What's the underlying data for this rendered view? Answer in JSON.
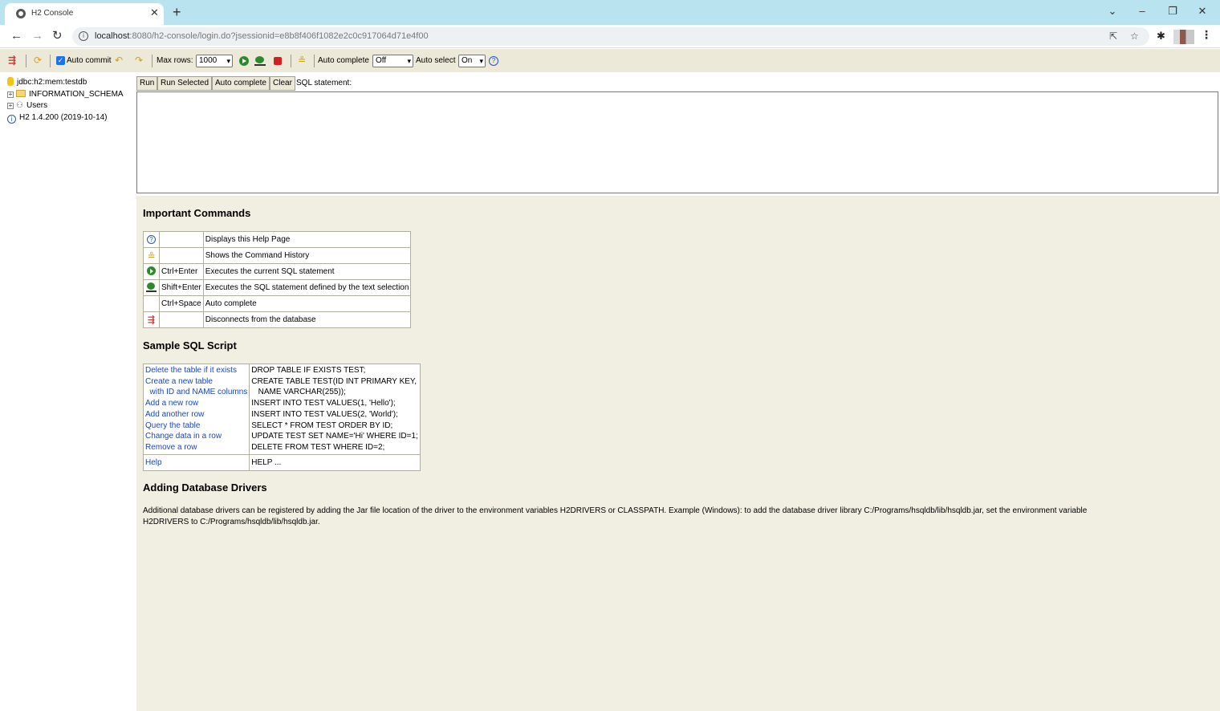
{
  "browser": {
    "tab_title": "H2 Console",
    "url_host": "localhost",
    "url_rest": ":8080/h2-console/login.do?jsessionid=e8b8f406f1082e2c0c917064d71e4f00"
  },
  "toolbar": {
    "auto_commit_label": "Auto commit",
    "max_rows_label": "Max rows:",
    "max_rows_value": "1000",
    "auto_complete_label": "Auto complete",
    "auto_complete_value": "Off",
    "auto_select_label": "Auto select",
    "auto_select_value": "On"
  },
  "tree": {
    "connection": "jdbc:h2:mem:testdb",
    "schema": "INFORMATION_SCHEMA",
    "users": "Users",
    "version": "H2 1.4.200 (2019-10-14)"
  },
  "query": {
    "run": "Run",
    "run_selected": "Run Selected",
    "auto_complete": "Auto complete",
    "clear": "Clear",
    "sql_label": "SQL statement:"
  },
  "help": {
    "important_title": "Important Commands",
    "commands": [
      {
        "icon": "help-icon",
        "key": "",
        "desc": "Displays this Help Page"
      },
      {
        "icon": "history-icon",
        "key": "",
        "desc": "Shows the Command History"
      },
      {
        "icon": "run-icon",
        "key": "Ctrl+Enter",
        "desc": "Executes the current SQL statement"
      },
      {
        "icon": "run-selected-icon",
        "key": "Shift+Enter",
        "desc": "Executes the SQL statement defined by the text selection"
      },
      {
        "icon": "",
        "key": "Ctrl+Space",
        "desc": "Auto complete"
      },
      {
        "icon": "disconnect-icon",
        "key": "",
        "desc": "Disconnects from the database"
      }
    ],
    "sample_title": "Sample SQL Script",
    "sample_links": [
      "Delete the table if it exists",
      "Create a new table",
      "  with ID and NAME columns",
      "Add a new row",
      "Add another row",
      "Query the table",
      "Change data in a row",
      "Remove a row"
    ],
    "sample_sql": [
      "DROP TABLE IF EXISTS TEST;",
      "CREATE TABLE TEST(ID INT PRIMARY KEY,",
      "   NAME VARCHAR(255));",
      "INSERT INTO TEST VALUES(1, 'Hello');",
      "INSERT INTO TEST VALUES(2, 'World');",
      "SELECT * FROM TEST ORDER BY ID;",
      "UPDATE TEST SET NAME='Hi' WHERE ID=1;",
      "DELETE FROM TEST WHERE ID=2;"
    ],
    "help_link": "Help",
    "help_sql": "HELP ...",
    "drivers_title": "Adding Database Drivers",
    "drivers_text": "Additional database drivers can be registered by adding the Jar file location of the driver to the environment variables H2DRIVERS or CLASSPATH. Example (Windows): to add the database driver library C:/Programs/hsqldb/lib/hsqldb.jar, set the environment variable H2DRIVERS to C:/Programs/hsqldb/lib/hsqldb.jar."
  }
}
